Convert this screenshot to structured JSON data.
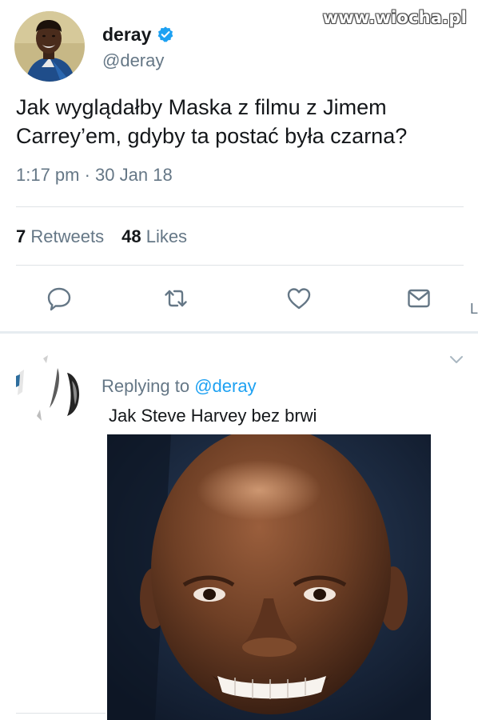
{
  "watermark": "www.wiocha.pl",
  "tweet": {
    "display_name": "deray",
    "handle": "@deray",
    "text": "Jak wyglądałby Maska z filmu z Jimem\nCarrey’em, gdyby ta postać była czarna?",
    "timestamp": "1:17 pm · 30 Jan 18",
    "retweets_count": "7",
    "retweets_label": "Retweets",
    "likes_count": "48",
    "likes_label": "Likes"
  },
  "actions": {
    "icons": [
      "reply-icon",
      "retweet-icon",
      "like-icon",
      "direct-message-icon"
    ],
    "color": "#657786"
  },
  "edge_fragment": "L",
  "reply": {
    "replying_prefix": "Replying to",
    "replying_to": "@deray",
    "text": "Jak Steve Harvey bez brwi"
  },
  "colors": {
    "link": "#1da1f2",
    "verified": "#1da1f2",
    "secondary_text": "#657786",
    "primary_text": "#14171a"
  }
}
